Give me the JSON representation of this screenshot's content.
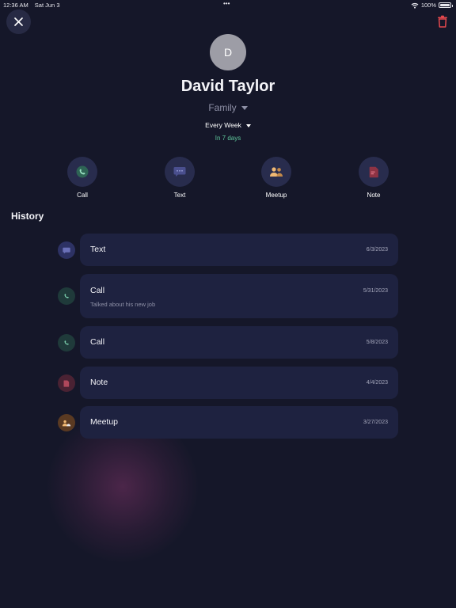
{
  "status_bar": {
    "time": "12:36 AM",
    "date": "Sat Jun 3",
    "dots": "•••",
    "battery": "100%",
    "battery_level": 1.0
  },
  "contact": {
    "initial": "D",
    "name": "David Taylor",
    "group": "Family",
    "frequency": "Every Week",
    "due": "In 7 days"
  },
  "actions": [
    {
      "label": "Call",
      "icon": "phone-icon"
    },
    {
      "label": "Text",
      "icon": "chat-bubble-icon"
    },
    {
      "label": "Meetup",
      "icon": "people-icon"
    },
    {
      "label": "Note",
      "icon": "note-icon"
    }
  ],
  "history": {
    "title": "History",
    "entries": [
      {
        "type": "Text",
        "date": "6/3/2023",
        "note": "",
        "icon": "chat-bubble-icon"
      },
      {
        "type": "Call",
        "date": "5/31/2023",
        "note": "Talked about his new job",
        "icon": "phone-icon"
      },
      {
        "type": "Call",
        "date": "5/8/2023",
        "note": "",
        "icon": "phone-icon"
      },
      {
        "type": "Note",
        "date": "4/4/2023",
        "note": "",
        "icon": "note-icon"
      },
      {
        "type": "Meetup",
        "date": "3/27/2023",
        "note": "",
        "icon": "people-icon"
      }
    ]
  },
  "colors": {
    "background": "#151729",
    "card": "#1e2240",
    "accent_green": "#5fc79b",
    "delete_red": "#e5484d"
  }
}
